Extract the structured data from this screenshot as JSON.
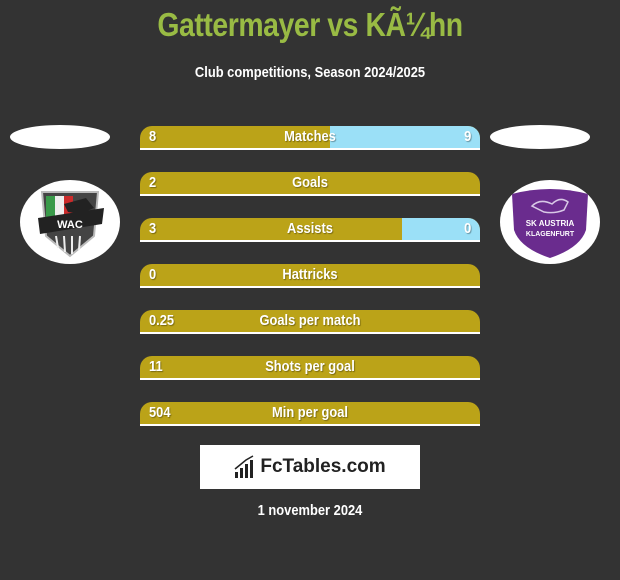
{
  "header": {
    "title": "Gattermayer vs KÃ¼hn",
    "subtitle": "Club competitions, Season 2024/2025"
  },
  "teams": {
    "left": {
      "name": "WAC",
      "logo_text": "WAC"
    },
    "right": {
      "name": "SK Austria Klagenfurt",
      "logo_line1": "SK AUSTRIA",
      "logo_line2": "KLAGENFURT"
    }
  },
  "colors": {
    "left_bar": "#bba318",
    "right_bar": "#9be0f7",
    "title": "#99bb44",
    "background": "#333333"
  },
  "stats": [
    {
      "label": "Matches",
      "left": "8",
      "right": "9",
      "right_fill": 0.44
    },
    {
      "label": "Goals",
      "left": "2",
      "right": "",
      "right_fill": 0
    },
    {
      "label": "Assists",
      "left": "3",
      "right": "0",
      "right_fill": 0.23
    },
    {
      "label": "Hattricks",
      "left": "0",
      "right": "",
      "right_fill": 0
    },
    {
      "label": "Goals per match",
      "left": "0.25",
      "right": "",
      "right_fill": 0
    },
    {
      "label": "Shots per goal",
      "left": "11",
      "right": "",
      "right_fill": 0
    },
    {
      "label": "Min per goal",
      "left": "504",
      "right": "",
      "right_fill": 0
    }
  ],
  "brand": {
    "name": "FcTables.com",
    "icon": "bar-chart-icon"
  },
  "footer": {
    "date": "1 november 2024"
  }
}
